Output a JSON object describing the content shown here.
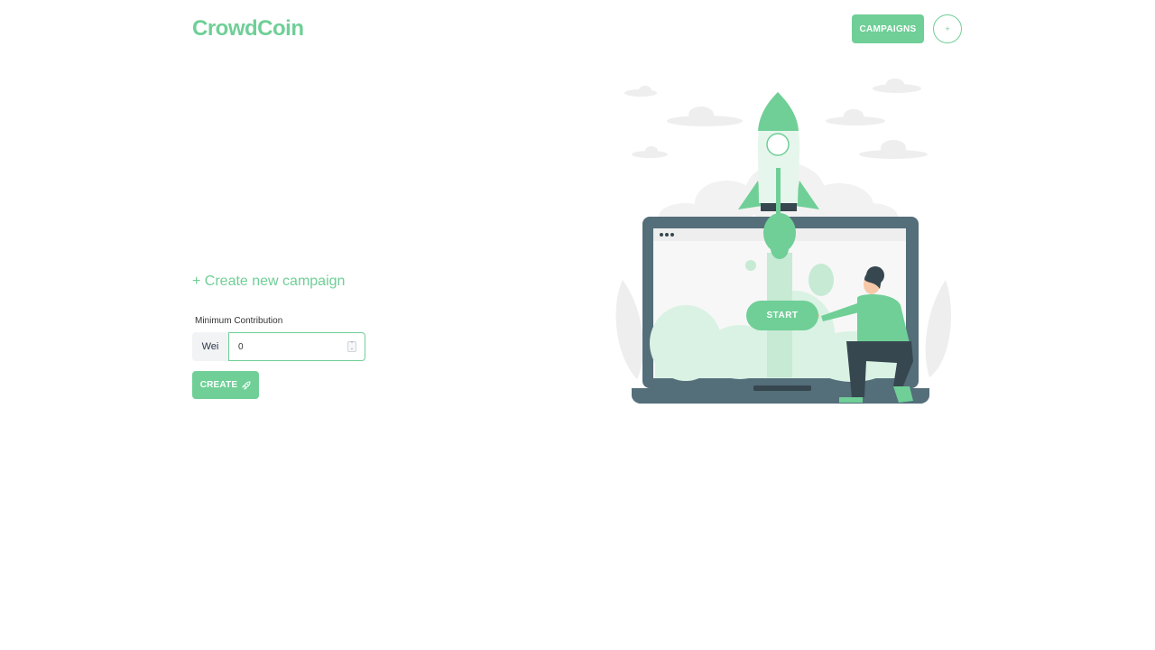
{
  "header": {
    "logo": "CrowdCoin",
    "campaigns_label": "CAMPAIGNS",
    "plus_label": "+"
  },
  "form": {
    "heading": "+ Create new campaign",
    "min_contribution_label": "Minimum Contribution",
    "unit_label": "Wei",
    "min_contribution_value": "0",
    "submit_label": "CREATE"
  },
  "illustration": {
    "start_label": "START"
  },
  "colors": {
    "accent": "#6fcf97",
    "dark": "#546e7a",
    "cloud": "#eeeeee"
  },
  "icons": {
    "submit": "rocket-icon",
    "stepper": "stepper-arrows-icon"
  }
}
